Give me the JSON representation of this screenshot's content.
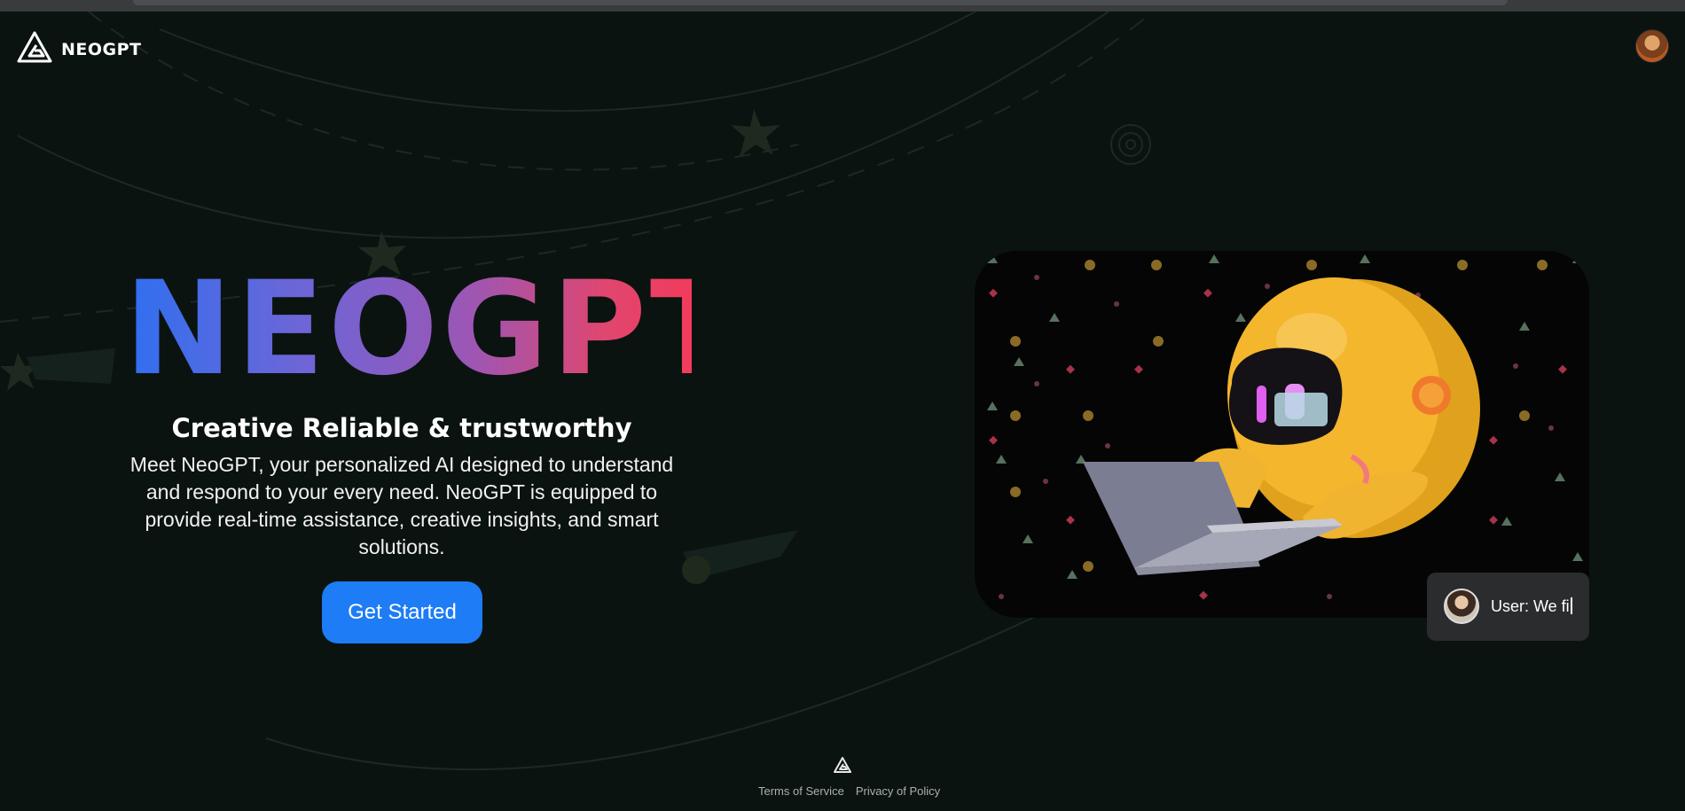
{
  "brand": {
    "name": "NEOGPT",
    "icon": "neogpt-logo-icon"
  },
  "header": {
    "avatar_icon": "user-avatar"
  },
  "hero": {
    "title": "NEOGPT",
    "tagline": "Creative Reliable & trustworthy",
    "description": "Meet NeoGPT, your personalized AI designed to understand and respond to your every need. NeoGPT is equipped to provide real-time assistance, creative insights, and smart solutions.",
    "cta_label": "Get Started",
    "title_gradient": [
      "#2f6ff0",
      "#9a57b6",
      "#f23b5c"
    ]
  },
  "media": {
    "illustration_icon": "robot-with-laptop-illustration"
  },
  "chat_bubble": {
    "text": "User: We fi",
    "avatar_icon": "user-avatar"
  },
  "footer": {
    "logo_icon": "neogpt-logo-icon",
    "links": [
      {
        "label": "Terms of Service"
      },
      {
        "label": "Privacy of Policy"
      }
    ]
  },
  "colors": {
    "background": "#0b1310",
    "accent": "#1d7cf6",
    "chat_bubble": "#2b2c2d"
  }
}
